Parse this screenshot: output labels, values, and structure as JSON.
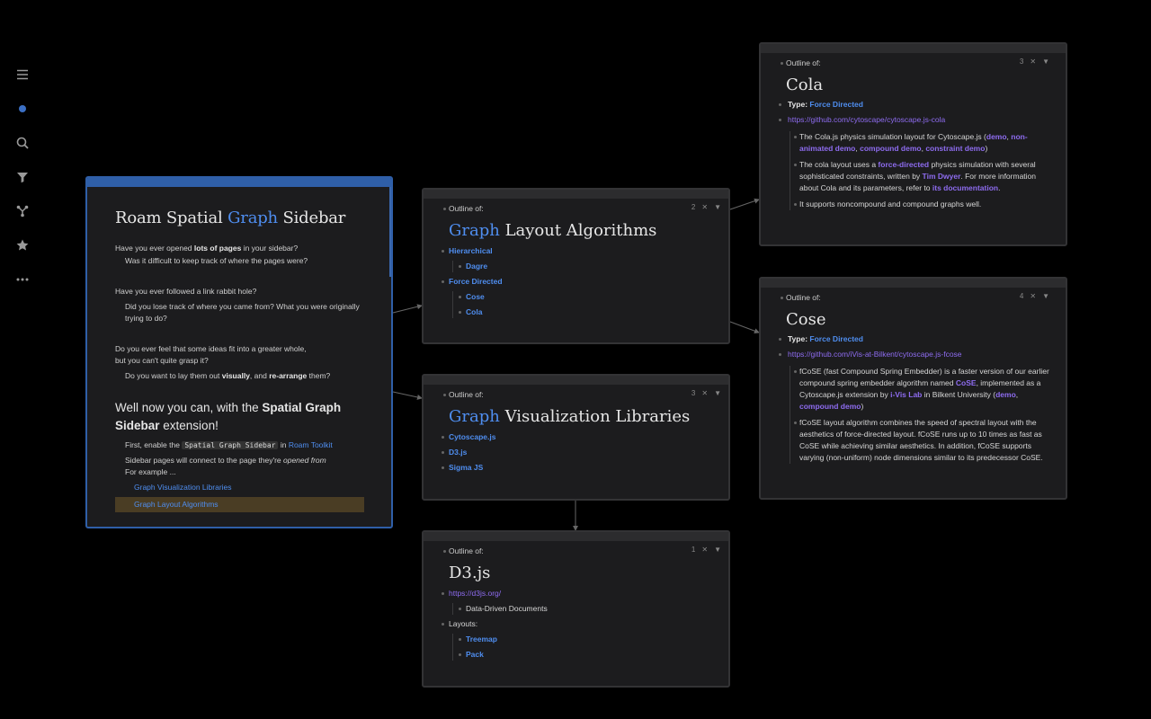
{
  "rail": {
    "items": [
      {
        "name": "menu-icon"
      },
      {
        "name": "graph-dot-icon"
      },
      {
        "name": "search-icon"
      },
      {
        "name": "filter-icon"
      },
      {
        "name": "graph-branch-icon"
      },
      {
        "name": "star-icon"
      },
      {
        "name": "more-icon"
      }
    ]
  },
  "main": {
    "title_pre": "Roam Spatial ",
    "title_hl": "Graph",
    "title_post": " Sidebar",
    "q1": {
      "pre": "Have you ever opened ",
      "bold": "lots of pages",
      "post": " in your sidebar?"
    },
    "q1a": "Was it difficult to keep track of where the pages were?",
    "q2": "Have you ever followed a link rabbit hole?",
    "q2a": "Did you lose track of where you came from? What you were originally trying to do?",
    "q3a": "Do you ever feel that some ideas fit into a greater whole,",
    "q3b": "but you can't quite grasp it?",
    "q3c": {
      "pre": "Do you want to lay them out ",
      "b1": "visually",
      "mid": ", and ",
      "b2": "re-arrange",
      "post": " them?"
    },
    "h2": {
      "pre": "Well now you can, with the ",
      "bold": "Spatial Graph Sidebar",
      "post": " extension!"
    },
    "enable": {
      "pre": "First, enable the ",
      "code": "Spatial Graph Sidebar",
      "mid": " in ",
      "link": "Roam Toolkit"
    },
    "connect": {
      "pre": "Sidebar pages will connect to the page they're ",
      "em": "opened from"
    },
    "example": "For example ...",
    "link1": "Graph Visualization Libraries",
    "link2": "Graph Layout Algorithms"
  },
  "cards": {
    "layout": {
      "label": "Outline of:",
      "num": "2",
      "title_hl": "Graph",
      "title_post": " Layout Algorithms",
      "items": [
        "Hierarchical",
        "Dagre",
        "Force Directed",
        "Cose",
        "Cola"
      ]
    },
    "viz": {
      "label": "Outline of:",
      "num": "3",
      "title_hl": "Graph",
      "title_post": " Visualization Libraries",
      "items": [
        "Cytoscape.js",
        "D3.js",
        "Sigma JS"
      ]
    },
    "d3": {
      "label": "Outline of:",
      "num": "1",
      "title": "D3.js",
      "url": "https://d3js.org/",
      "ddd": "Data-Driven Documents",
      "layouts": "Layouts:",
      "items": [
        "Treemap",
        "Pack"
      ]
    },
    "cola": {
      "label": "Outline of:",
      "num": "3",
      "title": "Cola",
      "type_label": "Type:",
      "type_val": "Force Directed",
      "url": "https://github.com/cytoscape/cytoscape.js-cola",
      "p1": {
        "pre": "The Cola.js physics simulation layout for Cytoscape.js (",
        "l1": "demo",
        "s1": ", ",
        "l2": "non-animated demo",
        "s2": ", ",
        "l3": "compound demo",
        "s3": ", ",
        "l4": "constraint demo",
        "post": ")"
      },
      "p2": {
        "pre": "The cola layout uses a ",
        "l1": "force-directed",
        "mid": " physics simulation with several sophisticated constraints, written by ",
        "l2": "Tim Dwyer",
        "mid2": ". For more information about Cola and its parameters, refer to ",
        "l3": "its documentation",
        "post": "."
      },
      "p3": "It supports noncompound and compound graphs well."
    },
    "cose": {
      "label": "Outline of:",
      "num": "4",
      "title": "Cose",
      "type_label": "Type:",
      "type_val": "Force Directed",
      "url": "https://github.com/iVis-at-Bilkent/cytoscape.js-fcose",
      "p1": {
        "pre": "fCoSE (fast Compound Spring Embedder) is a faster version of our earlier compound spring embedder algorithm named ",
        "l1": "CoSE",
        "mid": ", implemented as a Cytoscape.js extension by ",
        "l2": "i-Vis Lab",
        "mid2": " in Bilkent University (",
        "l3": "demo",
        "s": ", ",
        "l4": "compound demo",
        "post": ")"
      },
      "p2": "fCoSE layout algorithm combines the speed of spectral layout with the aesthetics of force-directed layout. fCoSE runs up to 10 times as fast as CoSE while achieving similar aesthetics. In addition, fCoSE supports varying (non-uniform) node dimensions similar to its predecessor CoSE."
    }
  },
  "colors": {
    "accent": "#4f8ef0",
    "purple": "#8e6cf0",
    "main_border": "#2f5fa8"
  }
}
